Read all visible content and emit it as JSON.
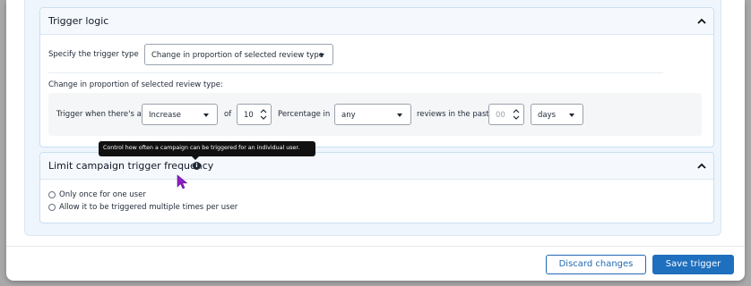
{
  "trigger_logic": {
    "title": "Trigger logic",
    "type_label": "Specify the trigger type",
    "type_value": "Change in proportion of selected review type",
    "section_label": "Change in proportion of selected review type:",
    "row": {
      "prefix": "Trigger when there's a",
      "direction_value": "Increase",
      "of_label": "of",
      "amount_value": "10",
      "percentage_label": "Percentage in",
      "review_type_value": "any",
      "reviews_label": "reviews in the past",
      "period_placeholder": "00",
      "unit_value": "days"
    }
  },
  "limit_frequency": {
    "title": "Limit campaign trigger frequency",
    "tooltip": "Control how often a campaign can be triggered for an individual user.",
    "options": [
      {
        "label": "Only once for one user"
      },
      {
        "label": "Allow it to be triggered multiple times per user"
      }
    ]
  },
  "footer": {
    "discard_label": "Discard changes",
    "save_label": "Save trigger"
  },
  "colors": {
    "primary": "#1f6fbf",
    "panel_bg": "#eef5fc",
    "card_border": "#c9dff2",
    "tooltip_bg": "#111111",
    "cursor": "#8b1fc7"
  },
  "icons": [
    "chevron-up-icon",
    "chevron-up-icon",
    "caret-down-icon",
    "spinner-arrows-icon",
    "info-icon",
    "mouse-cursor-icon"
  ]
}
